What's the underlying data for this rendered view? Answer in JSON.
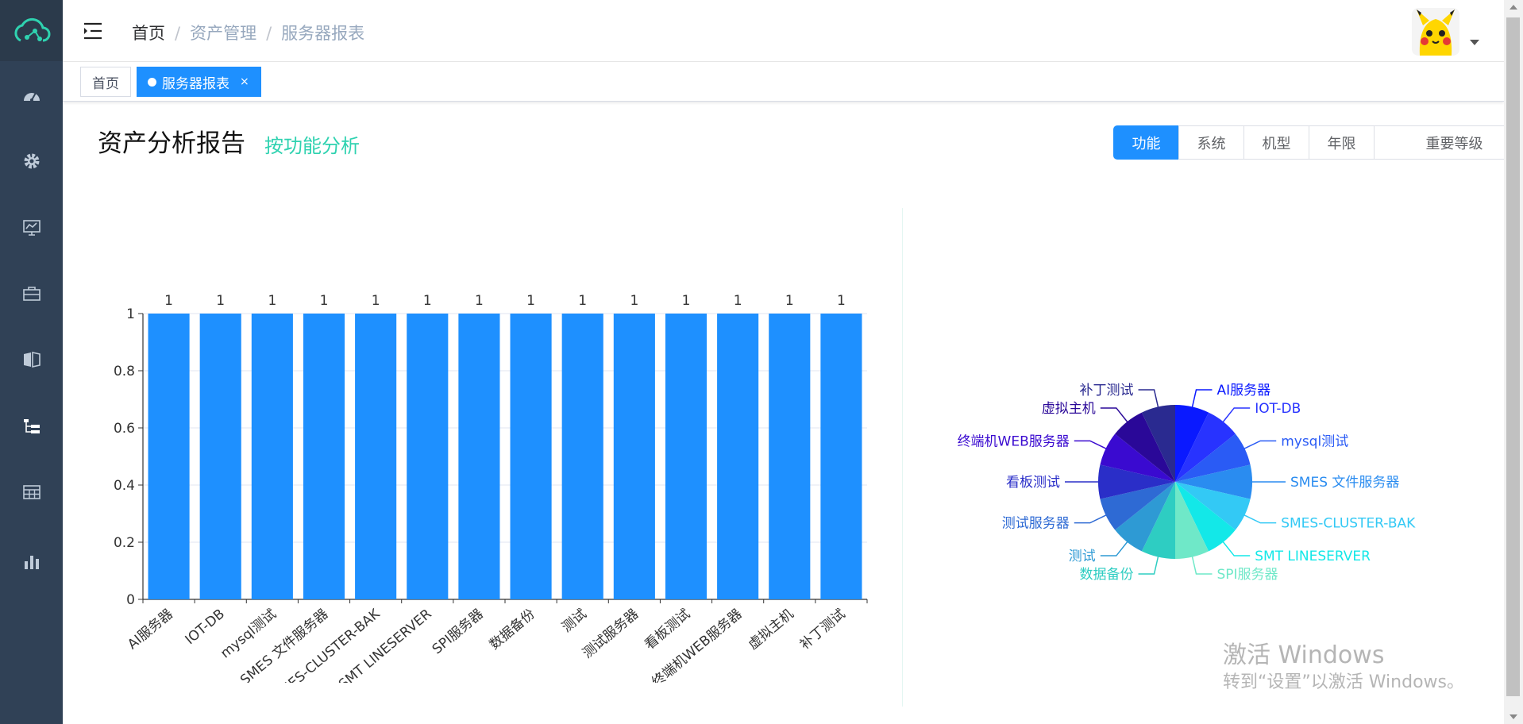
{
  "breadcrumb": {
    "home": "首页",
    "level2": "资产管理",
    "level3": "服务器报表",
    "separator": "/"
  },
  "tags": {
    "home": "首页",
    "active": "服务器报表",
    "close": "×"
  },
  "page": {
    "title": "资产分析报告",
    "subtitle": "按功能分析"
  },
  "filters": [
    "功能",
    "系统",
    "机型",
    "年限",
    "重要等级"
  ],
  "filter_active": "功能",
  "watermark": {
    "line1": "激活 Windows",
    "line2": "转到“设置”以激活 Windows。"
  },
  "sidebar": {
    "icons": [
      "dashboard-icon",
      "gear-icon",
      "monitor-chart-icon",
      "briefcase-icon",
      "book-icon",
      "tree-list-icon",
      "table-icon",
      "bar-chart-icon"
    ]
  },
  "colors": {
    "sidebar": "#304156",
    "accent": "#1e90ff",
    "subtitle": "#2fd2b0",
    "bar": "#1e90ff"
  },
  "chart_data": [
    {
      "type": "bar",
      "categories": [
        "AI服务器",
        "IOT-DB",
        "mysql测试",
        "SMES 文件服务器",
        "SMES-CLUSTER-BAK",
        "SMT LINESERVER",
        "SPI服务器",
        "数据备份",
        "测试",
        "测试服务器",
        "看板测试",
        "终端机WEB服务器",
        "虚拟主机",
        "补丁测试"
      ],
      "values": [
        1,
        1,
        1,
        1,
        1,
        1,
        1,
        1,
        1,
        1,
        1,
        1,
        1,
        1
      ],
      "yticks": [
        "0",
        "0.2",
        "0.4",
        "0.6",
        "0.8",
        "1"
      ],
      "ylim": [
        0,
        1
      ],
      "grid": true
    },
    {
      "type": "pie",
      "labels": [
        "AI服务器",
        "IOT-DB",
        "mysql测试",
        "SMES 文件服务器",
        "SMES-CLUSTER-BAK",
        "SMT LINESERVER",
        "SPI服务器",
        "数据备份",
        "测试",
        "测试服务器",
        "看板测试",
        "终端机WEB服务器",
        "虚拟主机",
        "补丁测试"
      ],
      "values": [
        1,
        1,
        1,
        1,
        1,
        1,
        1,
        1,
        1,
        1,
        1,
        1,
        1,
        1
      ],
      "colors": [
        "#0a19ff",
        "#2833ff",
        "#2a5bf5",
        "#2a8cf0",
        "#33c9f5",
        "#13e8e8",
        "#6fe8c8",
        "#2ecdc2",
        "#2e9ad4",
        "#2e6ad4",
        "#2a2ec8",
        "#3a0ad0",
        "#2a0898",
        "#2a2a90"
      ]
    }
  ]
}
